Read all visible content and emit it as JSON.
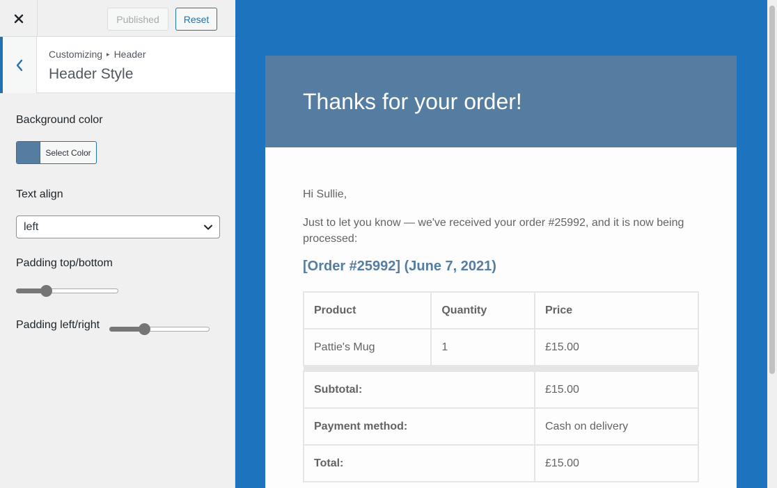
{
  "topbar": {
    "close_label": "Close",
    "published_label": "Published",
    "reset_label": "Reset"
  },
  "section": {
    "breadcrumb_root": "Customizing",
    "breadcrumb_leaf": "Header",
    "title": "Header Style"
  },
  "controls": {
    "background_color": {
      "label": "Background color",
      "button_label": "Select Color",
      "value": "#557da1"
    },
    "text_align": {
      "label": "Text align",
      "selected": "left"
    },
    "padding_top_bottom": {
      "label": "Padding top/bottom",
      "value_fraction": 0.27
    },
    "padding_left_right": {
      "label": "Padding left/right",
      "value_fraction": 0.33
    }
  },
  "email": {
    "header_bg": "#557da1",
    "title": "Thanks for your order!",
    "greeting": "Hi Sullie,",
    "message": "Just to let you know — we've received your order #25992, and it is now being processed:",
    "order_heading": "[Order #25992] (June 7, 2021)",
    "table": {
      "headers": [
        "Product",
        "Quantity",
        "Price"
      ],
      "items": [
        {
          "product": "Pattie's Mug",
          "quantity": "1",
          "price": "£15.00"
        }
      ],
      "totals": [
        {
          "label": "Subtotal:",
          "value": "£15.00"
        },
        {
          "label": "Payment method:",
          "value": "Cash on delivery"
        },
        {
          "label": "Total:",
          "value": "£15.00"
        }
      ]
    }
  },
  "colors": {
    "accent": "#2271b1",
    "preview_bg": "#1e73be"
  }
}
